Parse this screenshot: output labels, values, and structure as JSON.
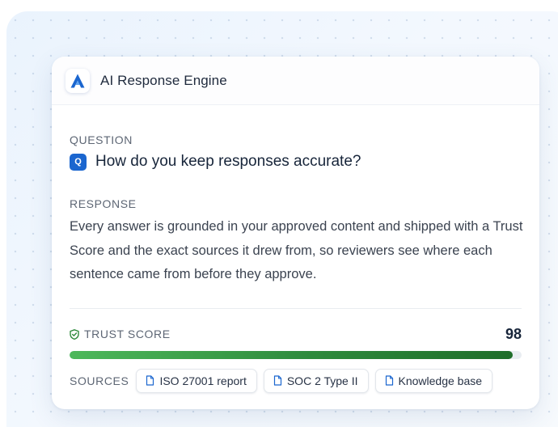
{
  "app": {
    "title": "AI Response Engine",
    "logo_icon": "a-logo-icon"
  },
  "question": {
    "label": "QUESTION",
    "badge": "Q",
    "text": "How do you keep responses accurate?"
  },
  "response": {
    "label": "RESPONSE",
    "text": "Every answer is grounded in your approved content and shipped with a Trust Score and the exact sources it drew from, so reviewers see where each sentence came from before they approve."
  },
  "trust": {
    "label": "TRUST SCORE",
    "value": "98",
    "score_percent": 98,
    "icon": "shield-check-icon"
  },
  "sources": {
    "label": "SOURCES",
    "items": [
      {
        "label": "ISO 27001 report",
        "icon": "document-icon"
      },
      {
        "label": "SOC 2 Type II",
        "icon": "document-icon"
      },
      {
        "label": "Knowledge base",
        "icon": "document-icon"
      }
    ]
  },
  "colors": {
    "brand_blue": "#1b66cf",
    "trust_green": "#2e8a3c",
    "text_dark": "#17253a"
  }
}
